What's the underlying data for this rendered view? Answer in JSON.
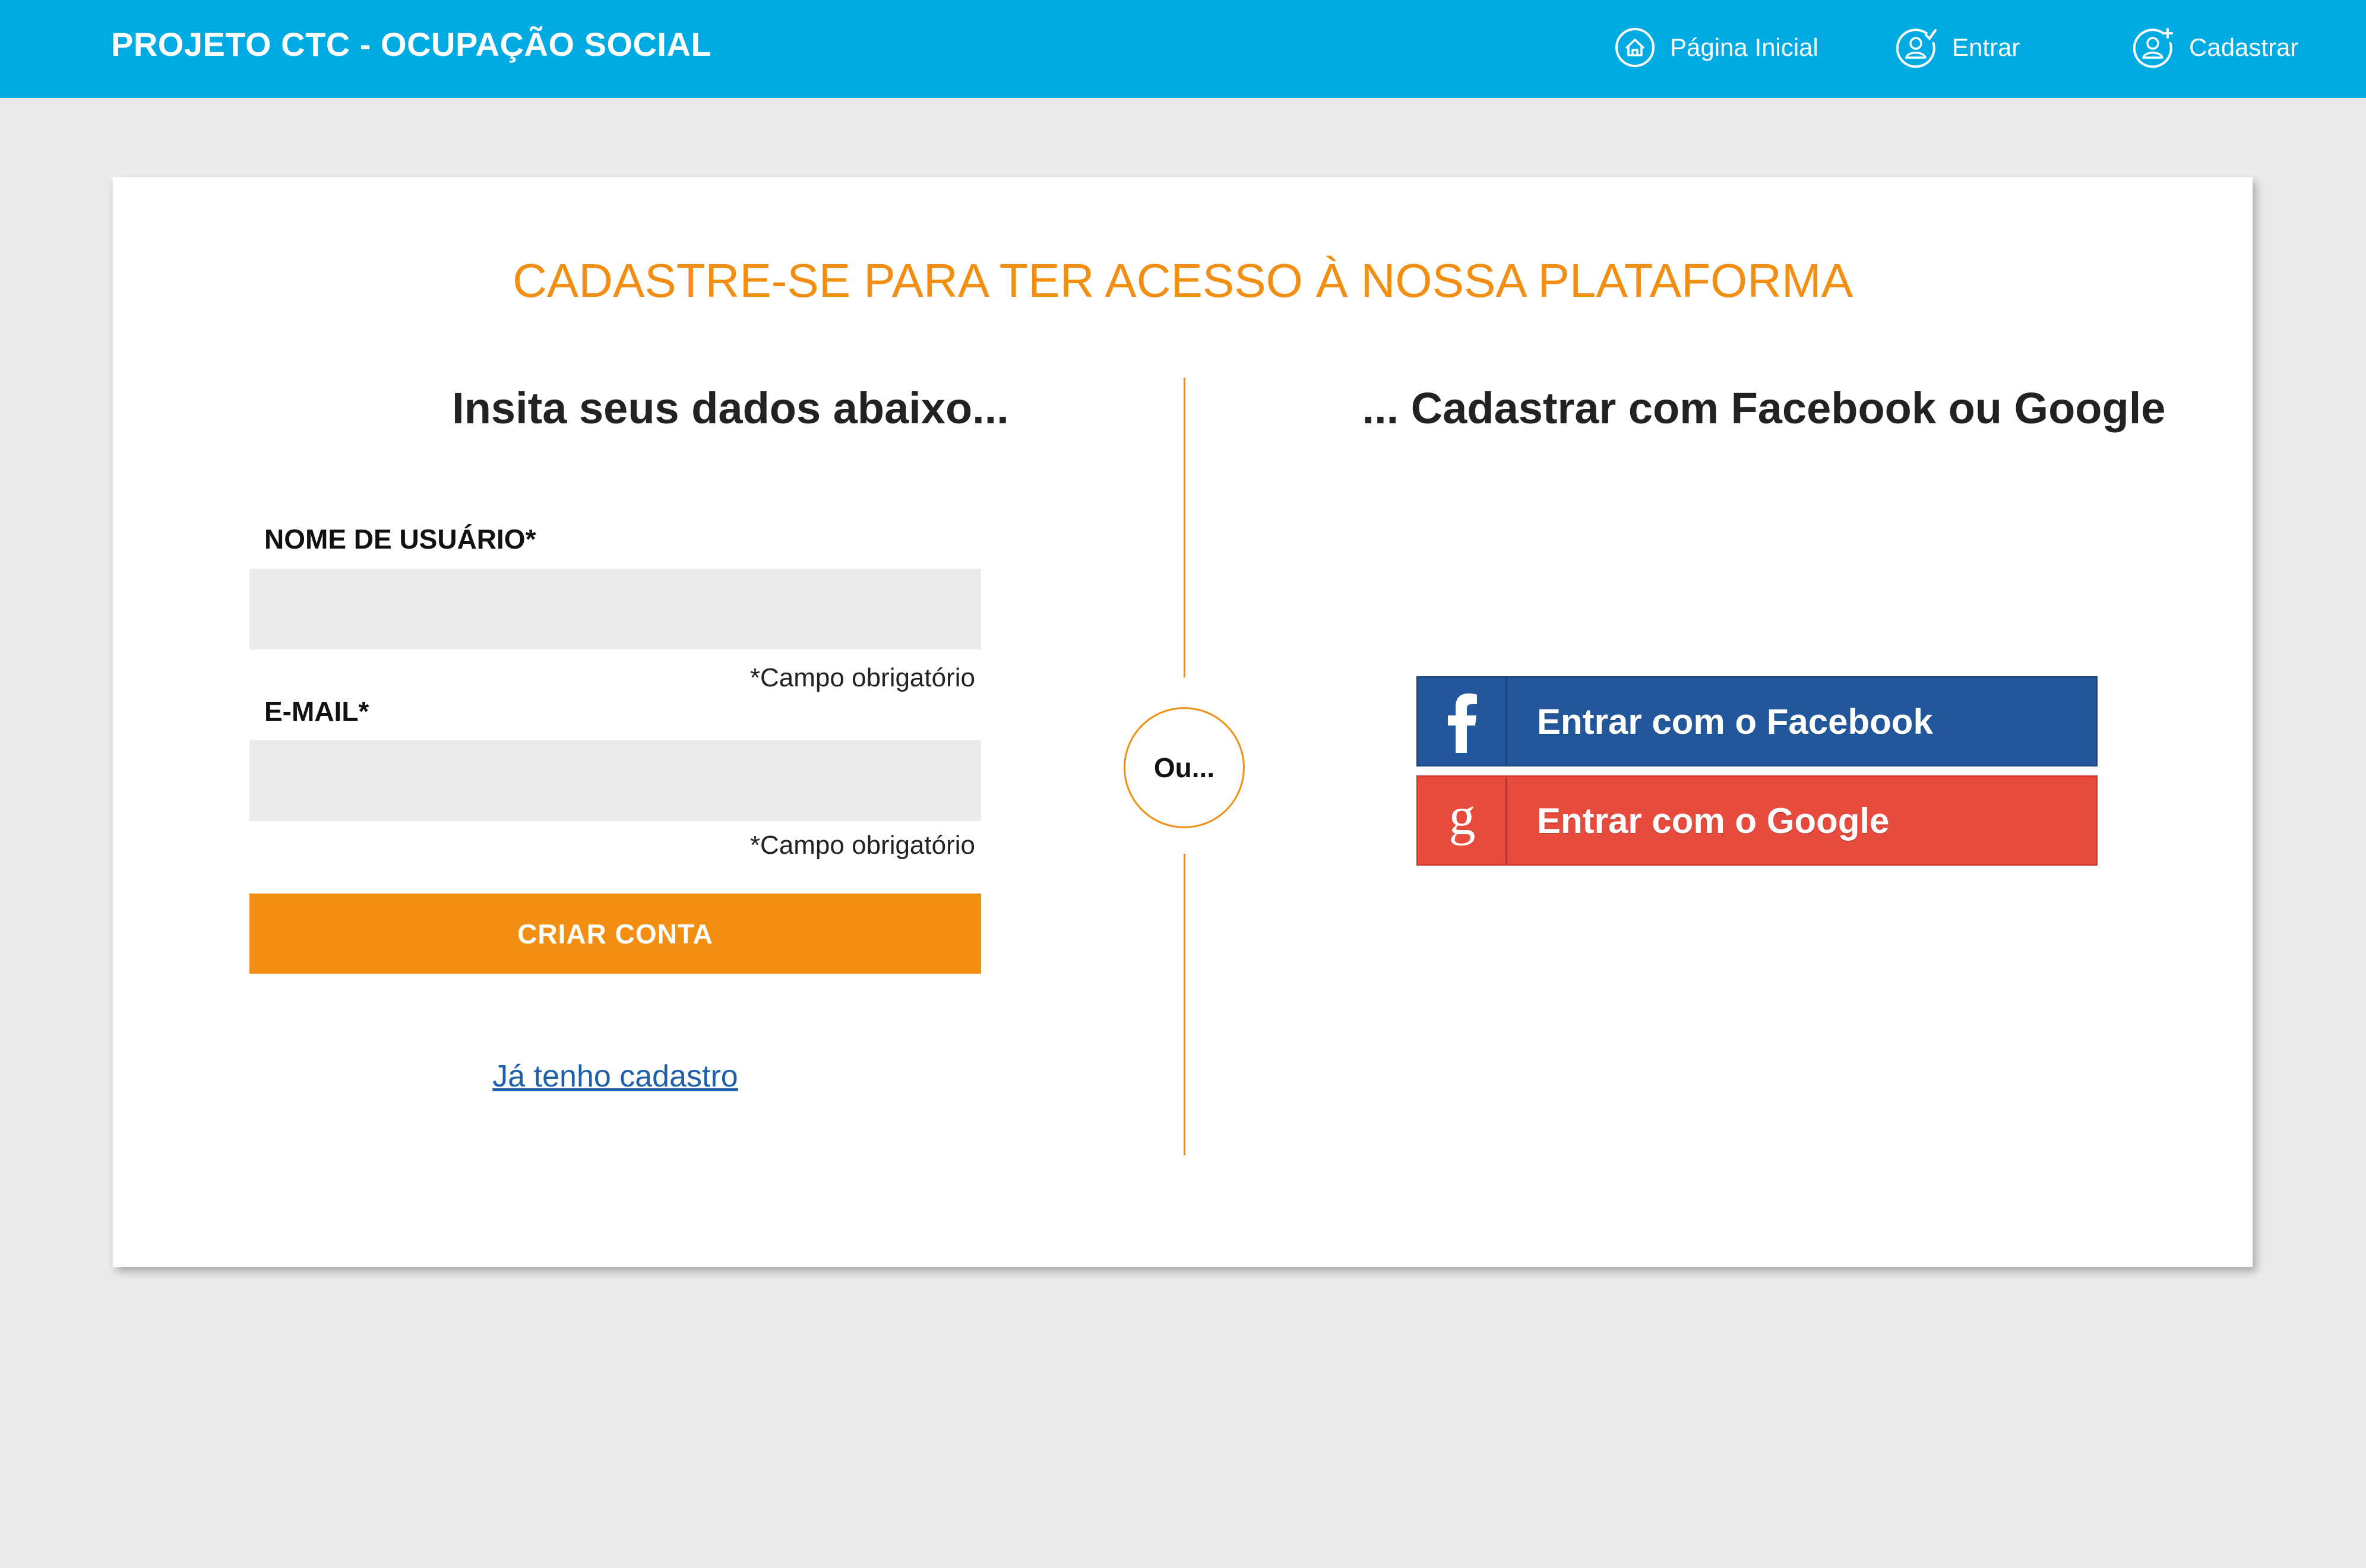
{
  "header": {
    "brand": "PROJETO CTC - OCUPAÇÃO SOCIAL",
    "nav": {
      "home": "Página Inicial",
      "login": "Entrar",
      "register": "Cadastrar"
    }
  },
  "card": {
    "title": "CADASTRE-SE PARA TER ACESSO À NOSSA PLATAFORMA",
    "left_heading": "Insita seus dados abaixo...",
    "right_heading": "... Cadastrar com Facebook ou Google",
    "form": {
      "username_label": "NOME DE USUÁRIO*",
      "username_value": "",
      "username_note": "*Campo obrigatório",
      "email_label": "E-MAIL*",
      "email_value": "",
      "email_note": "*Campo obrigatório",
      "submit_label": "CRIAR CONTA",
      "login_link": "Já tenho cadastro"
    },
    "divider_label": "Ou...",
    "social": {
      "facebook_label": "Entrar com o Facebook",
      "google_label": "Entrar com o Google"
    }
  },
  "colors": {
    "header_bg": "#00aae3",
    "accent_orange": "#f28f13",
    "facebook_blue": "#22579b",
    "google_red": "#e74b3d",
    "link_blue": "#1d5fa8",
    "page_bg": "#ebebeb"
  },
  "icons": {
    "home": "home-icon",
    "login": "user-check-icon",
    "register": "user-plus-icon",
    "facebook": "facebook-icon",
    "google": "google-icon"
  }
}
